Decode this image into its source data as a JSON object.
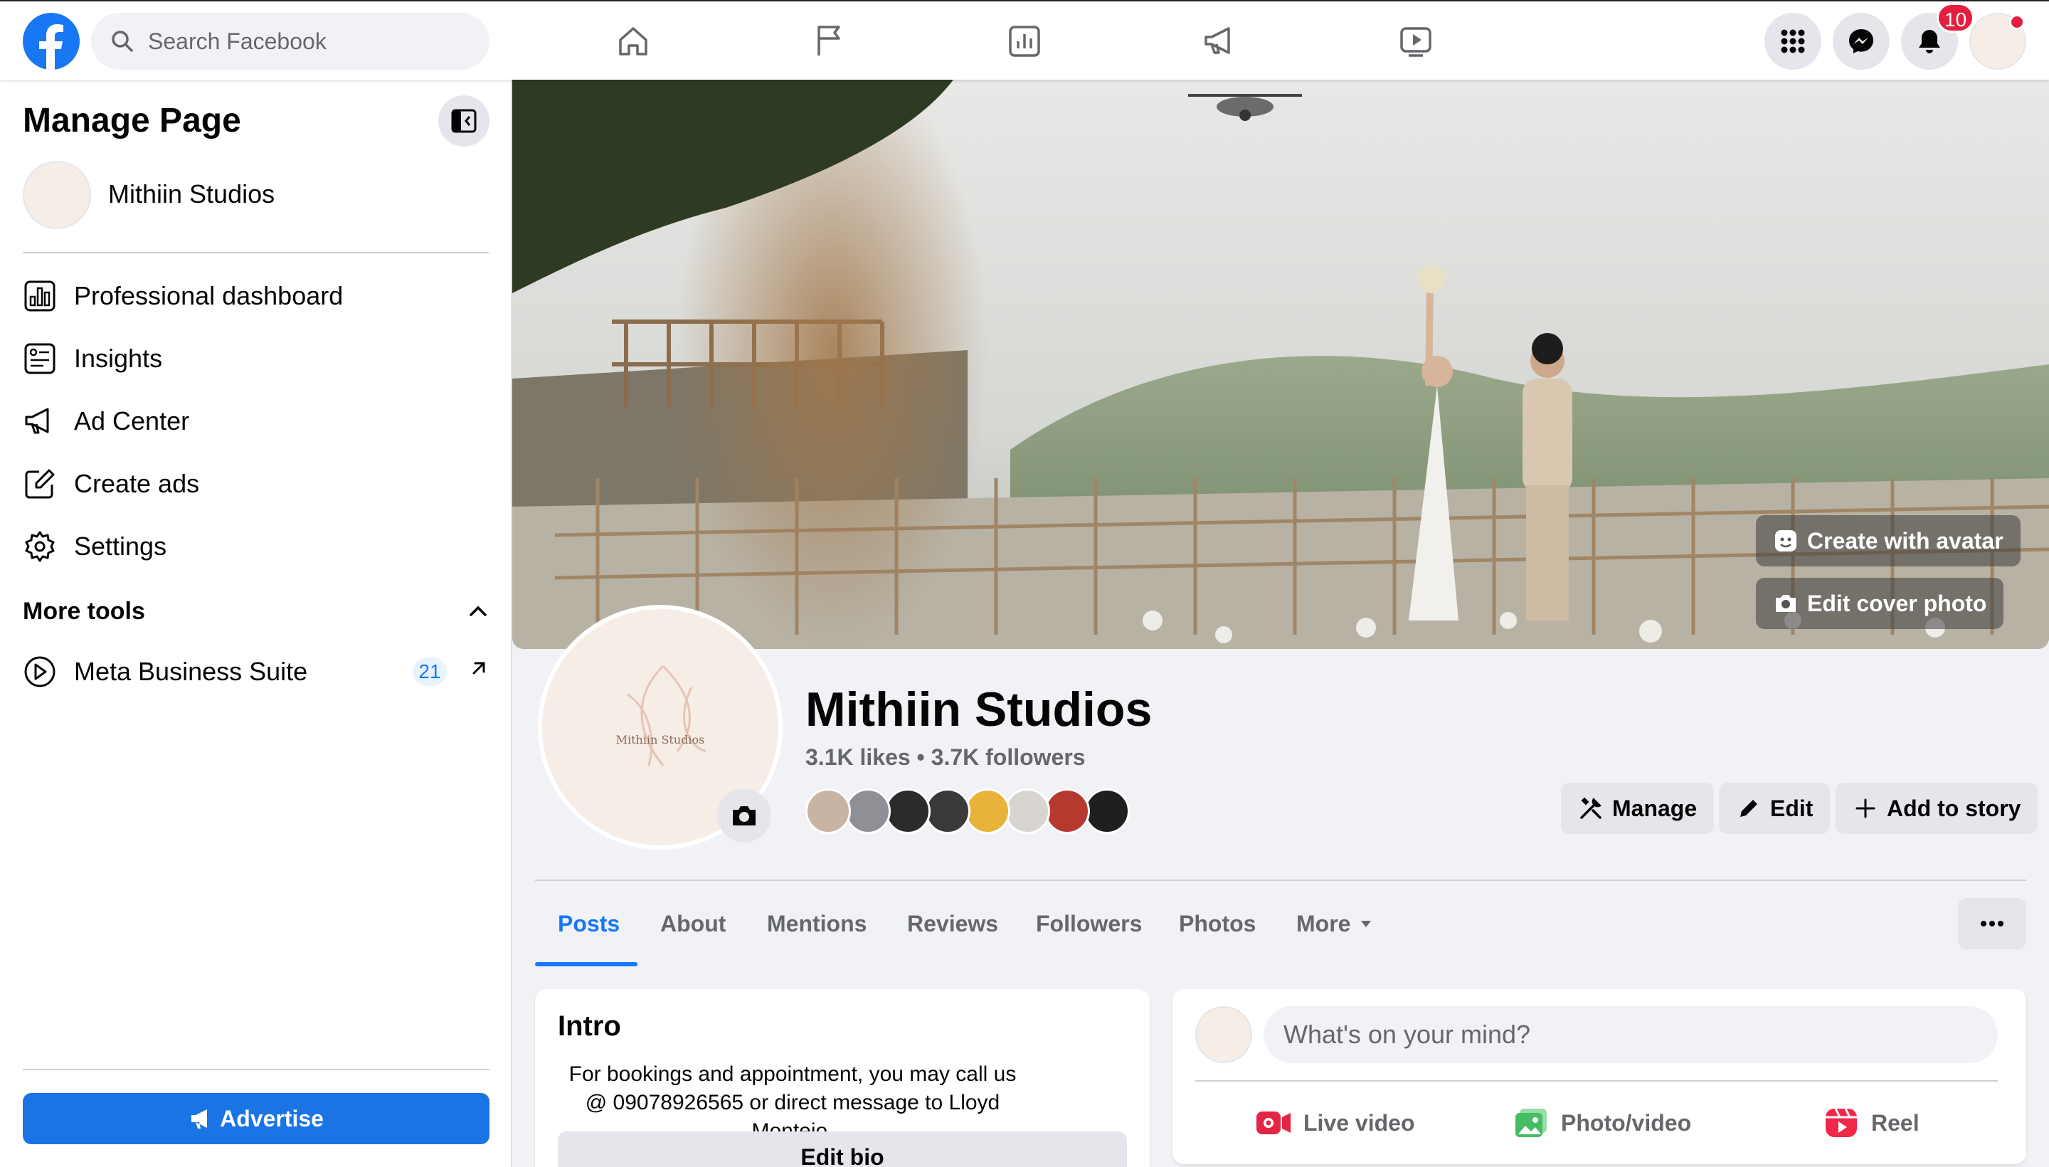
{
  "topbar": {
    "search_placeholder": "Search Facebook",
    "nav": [
      "home-icon",
      "flag-icon",
      "insights-icon",
      "megaphone-icon",
      "video-icon"
    ],
    "notification_count": "10"
  },
  "sidebar": {
    "title": "Manage Page",
    "page_name": "Mithiin Studios",
    "items": [
      {
        "label": "Professional dashboard",
        "icon": "dashboard-icon"
      },
      {
        "label": "Insights",
        "icon": "insights-icon"
      },
      {
        "label": "Ad Center",
        "icon": "megaphone-icon"
      },
      {
        "label": "Create ads",
        "icon": "edit-icon"
      },
      {
        "label": "Settings",
        "icon": "gear-icon"
      }
    ],
    "more_tools_label": "More tools",
    "meta_suite": {
      "label": "Meta Business Suite",
      "count": "21"
    },
    "advertise_label": "Advertise"
  },
  "cover": {
    "create_avatar_label": "Create with avatar",
    "edit_cover_label": "Edit cover photo"
  },
  "profile": {
    "name": "Mithiin Studios",
    "stats": "3.1K likes • 3.7K followers",
    "logo_text": "Mithiin Studios",
    "fan_colors": [
      "#c9b3a3",
      "#8f8f96",
      "#2b2b2b",
      "#3a3a3a",
      "#e9b23a",
      "#d8d4d0",
      "#b5392f",
      "#1f1f1f"
    ],
    "actions": {
      "manage": "Manage",
      "edit": "Edit",
      "add_story": "Add to story"
    }
  },
  "tabs": [
    "Posts",
    "About",
    "Mentions",
    "Reviews",
    "Followers",
    "Photos",
    "More"
  ],
  "intro": {
    "title": "Intro",
    "bio": "For bookings and appointment, you may call us @ 09078926565 or direct message to Lloyd Montejo.",
    "edit_bio_label": "Edit bio"
  },
  "composer": {
    "placeholder": "What's on your mind?",
    "actions": {
      "live": "Live video",
      "photo": "Photo/video",
      "reel": "Reel"
    }
  },
  "colors": {
    "brand": "#1877f2",
    "badge": "#e41e3f",
    "advertise": "#1b74e4"
  }
}
